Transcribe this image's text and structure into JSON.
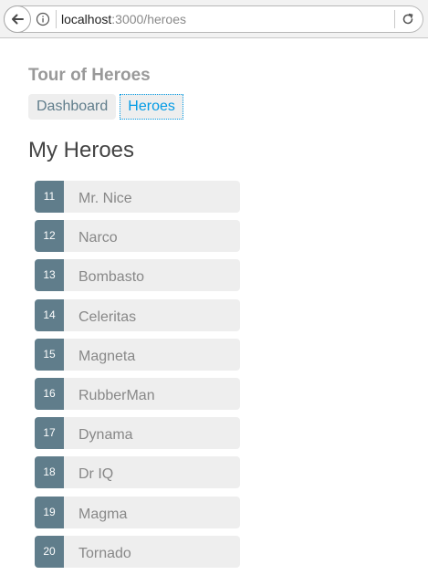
{
  "browser": {
    "url_host": "localhost",
    "url_path": ":3000/heroes"
  },
  "app": {
    "title": "Tour of Heroes",
    "nav": [
      {
        "label": "Dashboard",
        "active": false
      },
      {
        "label": "Heroes",
        "active": true
      }
    ]
  },
  "heroes_page": {
    "title": "My Heroes",
    "heroes": [
      {
        "id": "11",
        "name": "Mr. Nice"
      },
      {
        "id": "12",
        "name": "Narco"
      },
      {
        "id": "13",
        "name": "Bombasto"
      },
      {
        "id": "14",
        "name": "Celeritas"
      },
      {
        "id": "15",
        "name": "Magneta"
      },
      {
        "id": "16",
        "name": "RubberMan"
      },
      {
        "id": "17",
        "name": "Dynama"
      },
      {
        "id": "18",
        "name": "Dr IQ"
      },
      {
        "id": "19",
        "name": "Magma"
      },
      {
        "id": "20",
        "name": "Tornado"
      }
    ]
  },
  "icons": {
    "back": "back-arrow-icon",
    "info": "info-icon",
    "reload": "reload-icon"
  },
  "colors": {
    "badge_bg": "#607d8b",
    "item_bg": "#eeeeee",
    "active_link": "#039be5",
    "title": "#999999"
  }
}
